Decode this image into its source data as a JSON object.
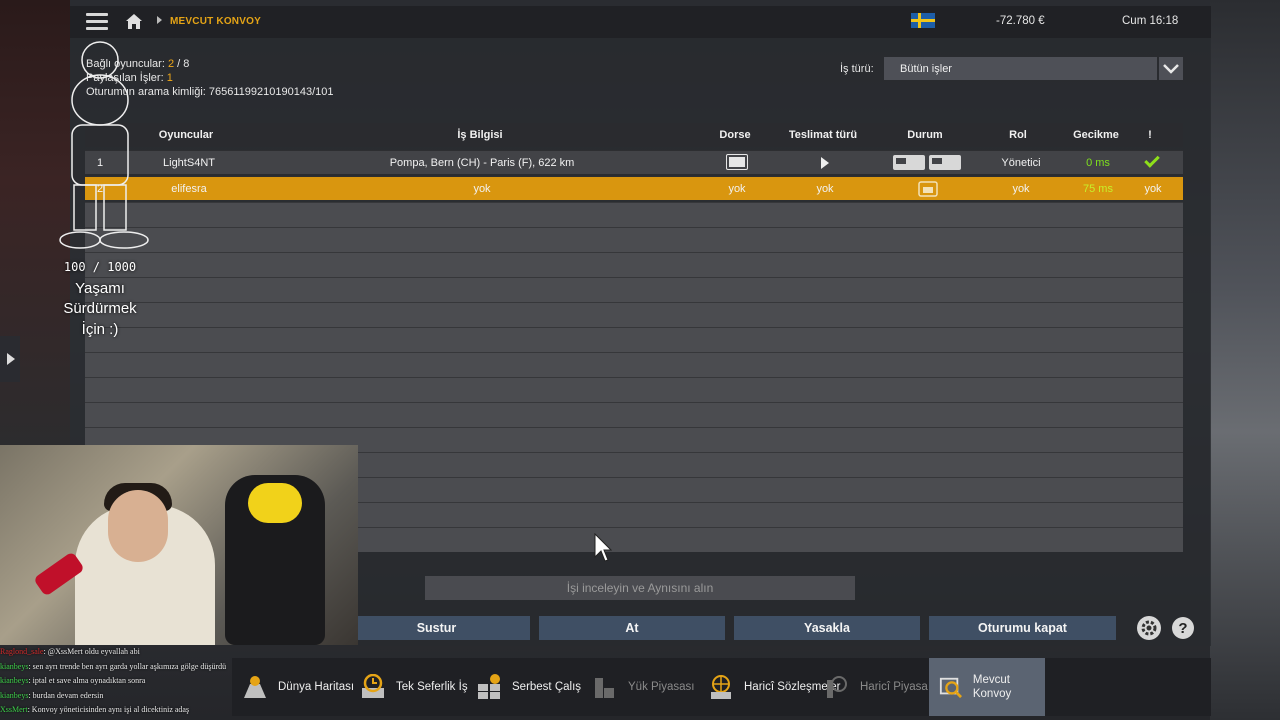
{
  "header": {
    "breadcrumb": "MEVCUT KONVOY",
    "balance": "-72.780 €",
    "clock": "Cum 16:18",
    "flag_icon": "sweden-flag-icon"
  },
  "session": {
    "players_label": "Bağlı oyuncular:",
    "players_count": "2",
    "players_max": "/ 8",
    "shared_label": "Paylaşılan İşler:",
    "shared_count": "1",
    "search_id_label": "Oturumun arama kimliği:",
    "search_id": "76561199210190143/101"
  },
  "filter": {
    "label": "İş türü:",
    "value": "Bütün işler"
  },
  "table": {
    "headers": [
      "Oyuncular",
      "İş Bilgisi",
      "Dorse",
      "Teslimat türü",
      "Durum",
      "Rol",
      "Gecikme",
      "!"
    ],
    "rows": [
      {
        "num": "1",
        "player": "LightS4NT",
        "job": "Pompa, Bern (CH) - Paris (F), 622 km",
        "trailer_icon": "trailer-icon",
        "delivery_icon": "play-icon",
        "status_icon": "truck-status-icon",
        "role": "Yönetici",
        "latency": "0 ms",
        "alert_icon": "check-icon"
      },
      {
        "num": "2",
        "player": "elifesra",
        "job": "yok",
        "trailer": "yok",
        "delivery": "yok",
        "status_icon": "garage-icon",
        "role": "yok",
        "latency": "75 ms",
        "alert": "yok"
      }
    ],
    "selected_row": 1,
    "colors": {
      "selected": "#d9960f",
      "latency_good": "#7ee01e",
      "latency_mid": "#c7f02a"
    }
  },
  "actions": {
    "inspect": "İşi inceleyin ve Aynısını alın",
    "mute": "Sustur",
    "kick": "At",
    "ban": "Yasakla",
    "close_session": "Oturumu kapat",
    "help": "?"
  },
  "nav": [
    "Dünya Haritası",
    "Tek Seferlik İş",
    "Serbest Çalış",
    "Yük Piyasası",
    "Haricî Sözleşmeler",
    "Haricî Piyasa",
    "Mevcut Konvoy"
  ],
  "overlay": {
    "counter": "100 / 1000",
    "line1": "Yaşamı",
    "line2": "Sürdürmek",
    "line3": "İçin :)"
  },
  "chat": [
    {
      "user": "Raglond_sale",
      "text": "@XssMert oldu eyvallah abi"
    },
    {
      "user": "kianbeys",
      "text": "sen ayrı trende ben ayrı garda yollar aşkımıza gölge düşürdü"
    },
    {
      "user": "kianbeys",
      "text": "iptal et save alma oynadıktan sonra"
    },
    {
      "user": "kianbeys",
      "text": "burdan devam edersin"
    },
    {
      "user": "XssMert",
      "text": "Konvoy yöneticisinden aynı işi al dicektiniz adaş"
    }
  ],
  "accent_color": "#e5a416"
}
